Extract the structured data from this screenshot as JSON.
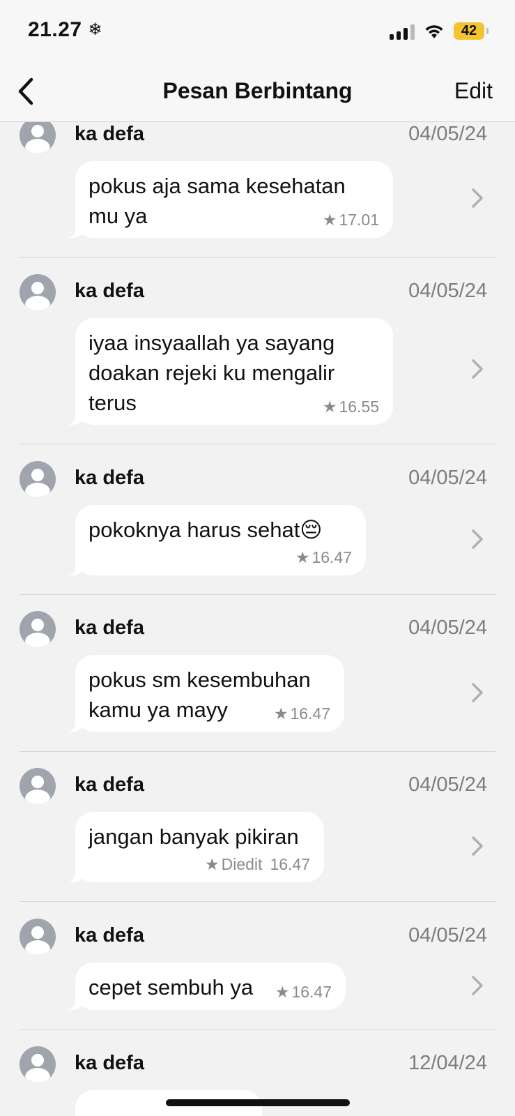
{
  "status_bar": {
    "time": "21.27",
    "time_extra_icon": "snowflake-icon",
    "battery": "42",
    "battery_color": "#f4c430"
  },
  "nav": {
    "title": "Pesan Berbintang",
    "edit_label": "Edit",
    "back_icon": "chevron-left-icon"
  },
  "messages": [
    {
      "sender": "ka defa",
      "date": "04/05/24",
      "lines": [
        "pokus aja sama kesehatan",
        "mu ya"
      ],
      "time": "17.01",
      "edited": ""
    },
    {
      "sender": "ka defa",
      "date": "04/05/24",
      "lines": [
        "iyaa insyaallah ya sayang",
        "doakan rejeki ku mengalir",
        "terus"
      ],
      "time": "16.55",
      "edited": ""
    },
    {
      "sender": "ka defa",
      "date": "04/05/24",
      "lines": [
        "pokoknya harus sehat😔"
      ],
      "time": "16.47",
      "edited": ""
    },
    {
      "sender": "ka defa",
      "date": "04/05/24",
      "lines": [
        "pokus sm kesembuhan",
        "kamu ya mayy"
      ],
      "time": "16.47",
      "edited": ""
    },
    {
      "sender": "ka defa",
      "date": "04/05/24",
      "lines": [
        "jangan banyak pikiran"
      ],
      "time": "16.47",
      "edited": "Diedit"
    },
    {
      "sender": "ka defa",
      "date": "04/05/24",
      "lines": [
        "cepet sembuh ya"
      ],
      "time": "16.47",
      "edited": ""
    },
    {
      "sender": "ka defa",
      "date": "12/04/24",
      "lines": [],
      "time": "",
      "edited": ""
    }
  ]
}
